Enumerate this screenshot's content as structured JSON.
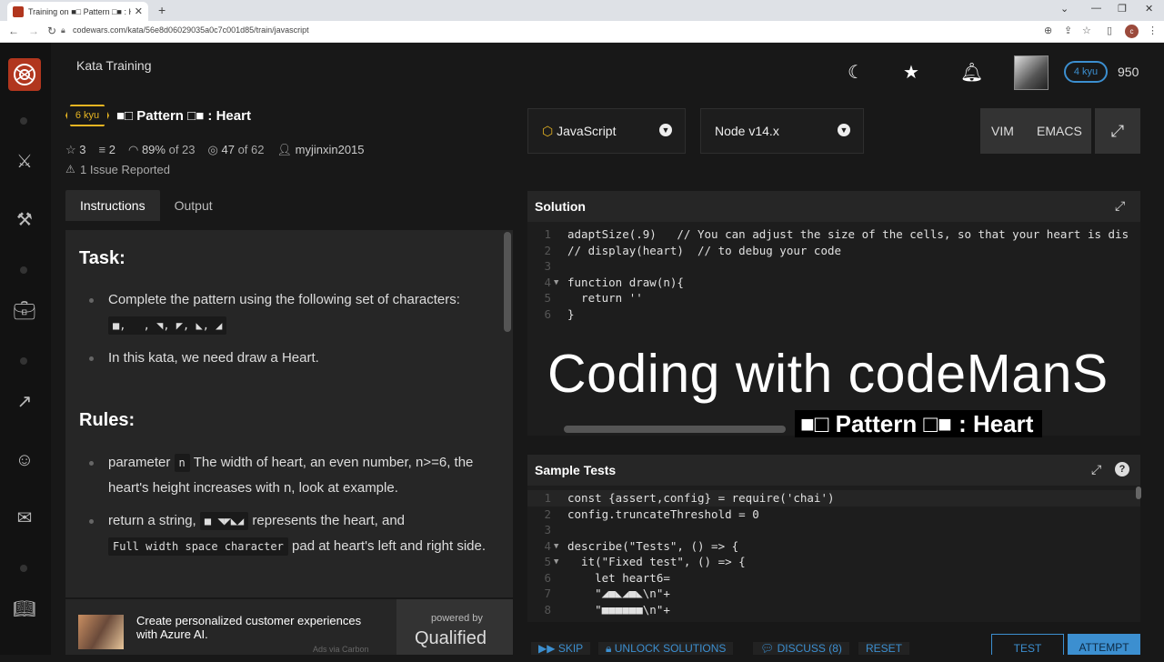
{
  "browser": {
    "tab_title": "Training on ■□ Pattern □■ : Hea",
    "tab_close": "✕",
    "new_tab": "+",
    "url": "codewars.com/kata/56e8d06029035a0c7c001d85/train/javascript",
    "profile": "c"
  },
  "header": {
    "page_title": "Kata Training",
    "user_rank": "4 kyu",
    "honor": "950"
  },
  "kata": {
    "rank": "6 kyu",
    "name": "■□ Pattern □■ : Heart",
    "stars": "3",
    "collections": "2",
    "satisfaction": "89%",
    "satisfaction_of": "of 23",
    "completed": "47",
    "completed_of": "of 62",
    "author": "myjinxin2015",
    "issues": "1 Issue Reported"
  },
  "tabs": [
    "Instructions",
    "Output"
  ],
  "instructions": {
    "task_heading": "Task:",
    "task_item1": "Complete the pattern using the following set of characters:",
    "task_chars": "■, 　, ◥, ◤, ◣, ◢",
    "task_item2": "In this kata, we need draw a Heart.",
    "rules_heading": "Rules:",
    "rule1_pre": "parameter",
    "rule1_code": "n",
    "rule1_post": "The width of heart, an even number, n>=6, the heart's height increases with n, look at example.",
    "rule2_pre": "return a string,",
    "rule2_code": "■ ◥◤◣◢",
    "rule2_post": "represents the heart, and",
    "rule2_code2": "Full width space character",
    "rule2_post2": "pad at heart's left and right side."
  },
  "ad": {
    "text": "Create personalized customer experiences with Azure AI.",
    "powered_by": "powered by",
    "brand": "Qualified",
    "via": "Ads via Carbon"
  },
  "toolbar": {
    "language": "JavaScript",
    "version": "Node v14.x",
    "vim": "VIM",
    "emacs": "EMACS"
  },
  "solution": {
    "heading": "Solution",
    "lines": [
      {
        "n": "1",
        "code": "adaptSize(.9)   // You can adjust the size of the cells, so that your heart is dis"
      },
      {
        "n": "2",
        "code": "// display(heart)  // to debug your code"
      },
      {
        "n": "3",
        "code": ""
      },
      {
        "n": "4",
        "code": "function draw(n){"
      },
      {
        "n": "5",
        "code": "  return ''"
      },
      {
        "n": "6",
        "code": "}"
      }
    ]
  },
  "overlay": {
    "line1": "Coding with codeManS",
    "line2": "■□ Pattern □■ : Heart"
  },
  "sample_tests": {
    "heading": "Sample Tests",
    "lines": [
      {
        "n": "1",
        "code": "const {assert,config} = require('chai')"
      },
      {
        "n": "2",
        "code": "config.truncateThreshold = 0"
      },
      {
        "n": "3",
        "code": ""
      },
      {
        "n": "4",
        "code": "describe(\"Tests\", () => {"
      },
      {
        "n": "5",
        "code": "  it(\"Fixed test\", () => {"
      },
      {
        "n": "6",
        "code": "    let heart6="
      },
      {
        "n": "7",
        "code": "    \"◢■◣◢■◣\\n\"+"
      },
      {
        "n": "8",
        "code": "    \"■■■■■■\\n\"+"
      }
    ]
  },
  "actions": {
    "skip": "SKIP",
    "unlock": "UNLOCK SOLUTIONS",
    "discuss": "DISCUSS (8)",
    "reset": "RESET",
    "test": "TEST",
    "attempt": "ATTEMPT"
  },
  "colors": {
    "brand": "#b1361e",
    "rank_yellow": "#e6b422",
    "rank_blue": "#3c8fd0"
  }
}
